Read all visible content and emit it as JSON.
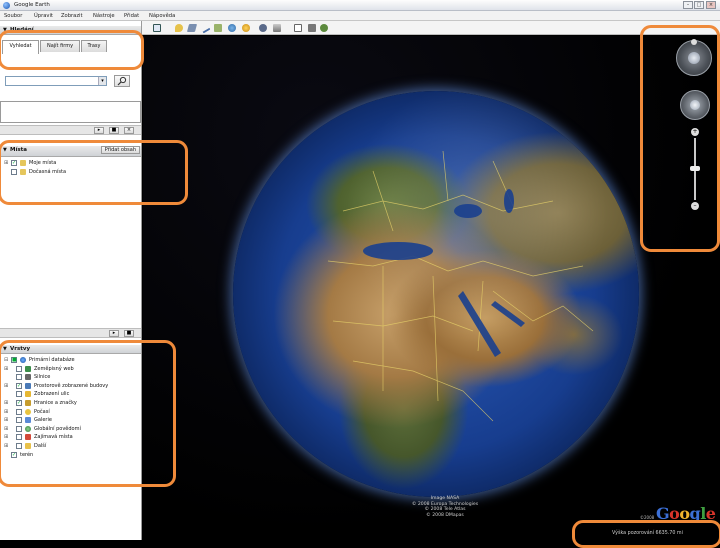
{
  "window": {
    "title": "Google Earth"
  },
  "menu": [
    "Soubor",
    "Úpravit",
    "Zobrazit",
    "Nástroje",
    "Přidat",
    "Nápověda"
  ],
  "search": {
    "header": "Hledání",
    "tabs": [
      "Vyhledat",
      "Najít firmy",
      "Trasy"
    ]
  },
  "places": {
    "header": "Místa",
    "add_content": "Přidat obsah",
    "items": [
      {
        "label": "Moje místa",
        "checked": true
      },
      {
        "label": "Dočasná místa",
        "checked": false
      }
    ]
  },
  "layers": {
    "header": "Vrstvy",
    "items": [
      {
        "label": "Primární databáze",
        "checked": true
      },
      {
        "label": "Zeměpisný web",
        "checked": false
      },
      {
        "label": "Silnice",
        "checked": false
      },
      {
        "label": "Prostorově zobrazené budovy",
        "checked": true
      },
      {
        "label": "Zobrazení ulic",
        "checked": false
      },
      {
        "label": "Hranice a značky",
        "checked": true
      },
      {
        "label": "Počasí",
        "checked": false
      },
      {
        "label": "Galerie",
        "checked": false
      },
      {
        "label": "Globální povědomí",
        "checked": false
      },
      {
        "label": "Zajímavá místa",
        "checked": false
      },
      {
        "label": "Další",
        "checked": false
      },
      {
        "label": "terén",
        "checked": true
      }
    ]
  },
  "attribution": [
    "Image NASA",
    "© 2008 Europa Technologies",
    "© 2008 Tele Atlas",
    "© 2008 DMapas"
  ],
  "logo": {
    "text": "Google",
    "copyright": "©2008"
  },
  "status": {
    "text": "Výška pozorování 6635.70 mi"
  },
  "colors": {
    "highlight": "#ef8a3a",
    "google_blue": "#3b6fd6",
    "google_red": "#d8342a",
    "google_yellow": "#f1b52d",
    "google_green": "#3f9e40"
  }
}
